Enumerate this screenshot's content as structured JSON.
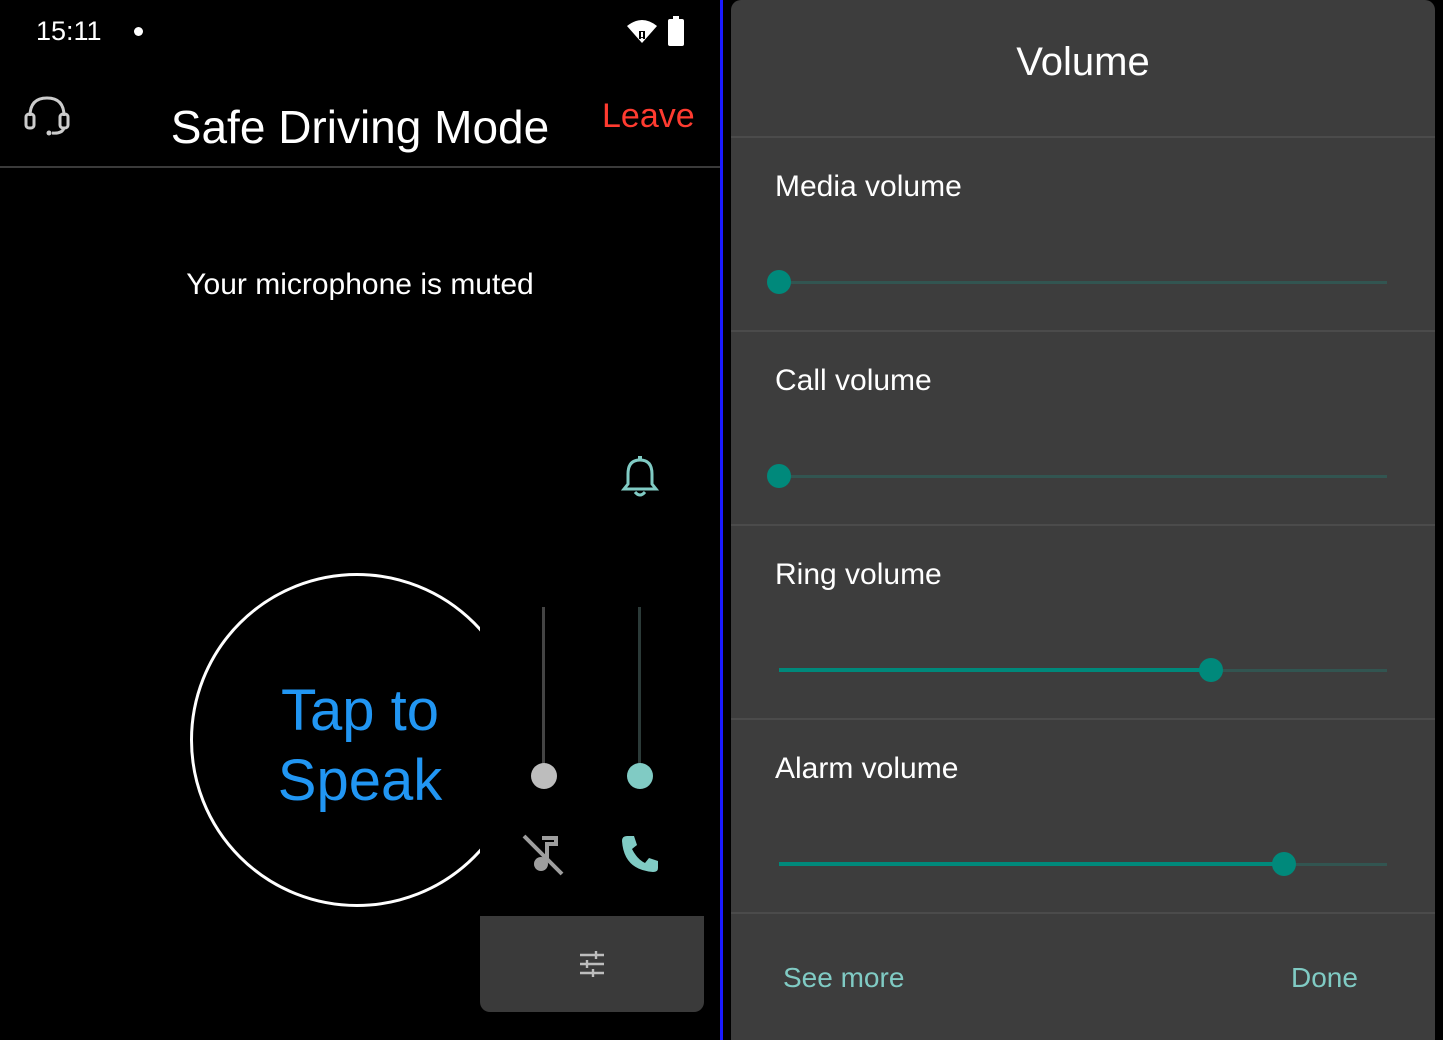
{
  "status_bar": {
    "time": "15:11"
  },
  "header": {
    "title": "Safe Driving Mode",
    "leave_label": "Leave"
  },
  "main": {
    "mute_notice": "Your microphone is muted",
    "tap_line1": "Tap to",
    "tap_line2": "Speak"
  },
  "colors": {
    "accent": "#00897b",
    "leave": "#ff3b30",
    "tap_text": "#2196f3",
    "dialog_bg": "#3d3d3d"
  },
  "icons": [
    "headset-icon",
    "wifi-icon",
    "battery-icon",
    "bell-icon",
    "music-off-icon",
    "phone-icon",
    "tune-icon"
  ],
  "volume_dialog": {
    "title": "Volume",
    "sliders": [
      {
        "label": "Media volume",
        "value": 0.0
      },
      {
        "label": "Call volume",
        "value": 0.0
      },
      {
        "label": "Ring volume",
        "value": 0.71
      },
      {
        "label": "Alarm volume",
        "value": 0.83
      }
    ],
    "see_more_label": "See more",
    "done_label": "Done"
  }
}
